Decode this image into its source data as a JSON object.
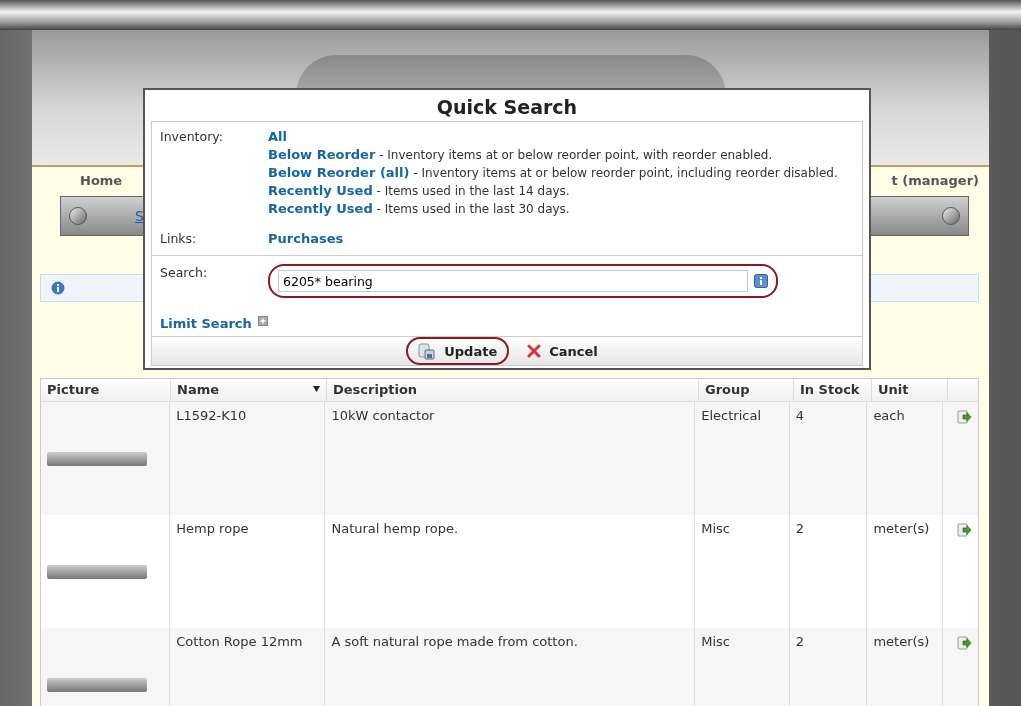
{
  "nav": {
    "left": "Home",
    "right": "t (manager)",
    "bar_link": "S"
  },
  "quick_search": {
    "title": "Quick Search",
    "inventory_label": "Inventory:",
    "inventory_links": [
      {
        "link": "All"
      },
      {
        "link": "Below Reorder",
        "note": " - Inventory items at or below reorder point, with reorder enabled."
      },
      {
        "link": "Below Reorder (all)",
        "note": " - Inventory items at or below reorder point, including reorder disabled."
      },
      {
        "link": "Recently Used",
        "note": " - Items used in the last 14 days."
      },
      {
        "link": "Recently Used",
        "note": " - Items used in the last 30 days."
      }
    ],
    "links_label": "Links:",
    "links": [
      "Purchases"
    ],
    "search_label": "Search:",
    "search_value": "6205* bearing",
    "limit_search": "Limit Search",
    "buttons": [
      {
        "kind": "update",
        "label": "Update"
      },
      {
        "kind": "cancel",
        "label": "Cancel"
      }
    ]
  },
  "table": {
    "columns": [
      {
        "label": "Picture",
        "sorted": false
      },
      {
        "label": "Name",
        "sorted": true
      },
      {
        "label": "Description",
        "sorted": false
      },
      {
        "label": "Group",
        "sorted": false
      },
      {
        "label": "In Stock",
        "sorted": false
      },
      {
        "label": "Unit",
        "sorted": false
      }
    ],
    "rows": [
      {
        "name": "L1592-K10",
        "description": "10kW contactor",
        "group": "Electrical",
        "in_stock": "4",
        "unit": "each"
      },
      {
        "name": "Hemp rope",
        "description": "Natural hemp rope.",
        "group": "Misc",
        "in_stock": "2",
        "unit": "meter(s)"
      },
      {
        "name": "Cotton Rope 12mm",
        "description": "A soft natural rope made from cotton.",
        "group": "Misc",
        "in_stock": "2",
        "unit": "meter(s)"
      }
    ]
  }
}
